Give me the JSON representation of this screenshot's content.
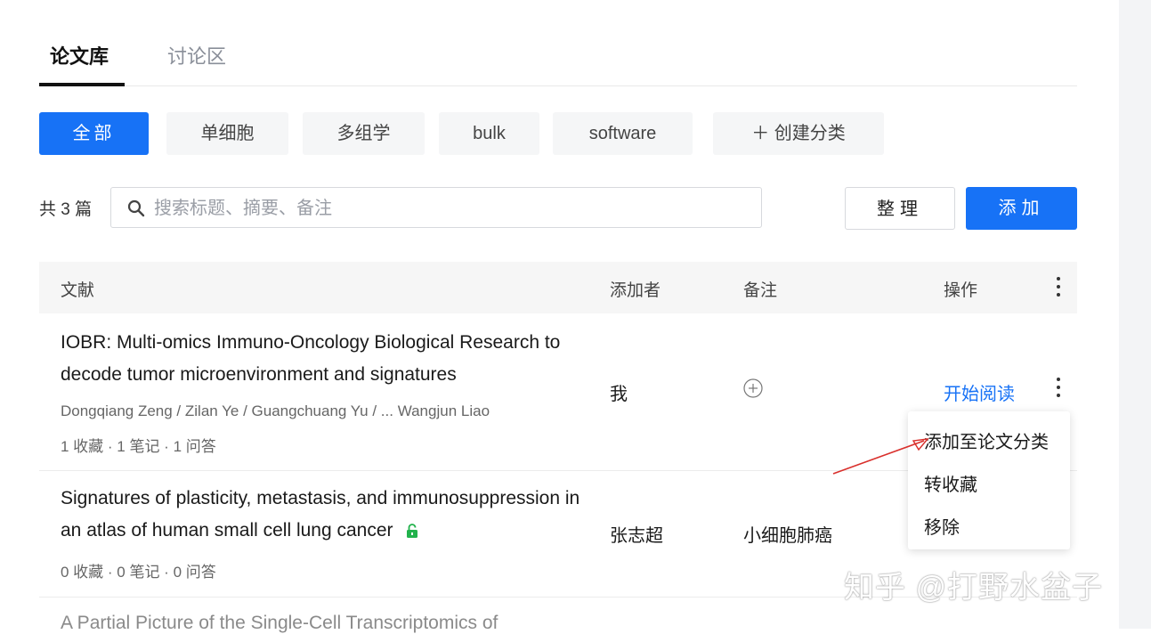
{
  "tabs": {
    "library": "论文库",
    "discussion": "讨论区"
  },
  "categories": [
    "全部",
    "单细胞",
    "多组学",
    "bulk",
    "software",
    "＋ 创建分类"
  ],
  "search": {
    "count_label": "共 3 篇",
    "placeholder": "搜索标题、摘要、备注"
  },
  "actions": {
    "organize": "整理",
    "add": "添加"
  },
  "table": {
    "headers": {
      "paper": "文献",
      "adder": "添加者",
      "note": "备注",
      "ops": "操作"
    },
    "rows": [
      {
        "title": "IOBR: Multi-omics Immuno-Oncology Biological Research to decode tumor microenvironment and signatures",
        "authors": "Dongqiang Zeng / Zilan Ye / Guangchuang Yu / ... Wangjun Liao",
        "stats": "1 收藏 · 1 笔记 · 1 问答",
        "adder": "我",
        "note": "",
        "action": "开始阅读"
      },
      {
        "title": "Signatures of plasticity, metastasis, and immunosuppression in an atlas of human small cell lung cancer",
        "stats": "0 收藏 · 0 笔记 · 0 问答",
        "adder": "张志超",
        "note": "小细胞肺癌",
        "open_access": true
      },
      {
        "title": "A Partial Picture of the Single-Cell Transcriptomics of"
      }
    ]
  },
  "menu": {
    "items": [
      "添加至论文分类",
      "转收藏",
      "移除"
    ]
  },
  "watermark": "知乎 @打野水盆子",
  "colors": {
    "accent": "#1772f6",
    "open_access_lock": "#22b24c",
    "annotation_arrow": "#d9302c"
  }
}
